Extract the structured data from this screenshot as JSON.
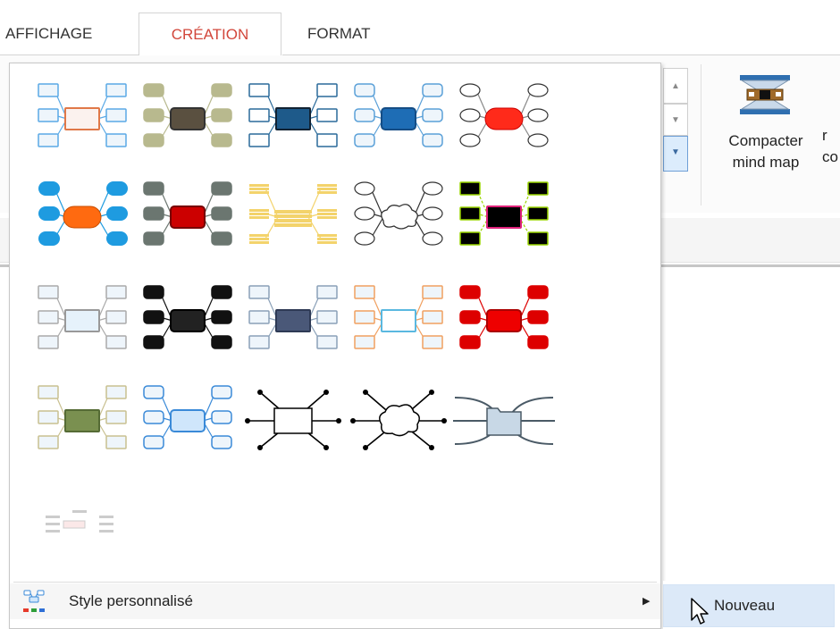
{
  "tabs": [
    {
      "label": "AFFICHAGE",
      "active": false
    },
    {
      "label": "CRÉATION",
      "active": true
    },
    {
      "label": "FORMAT",
      "active": false
    }
  ],
  "ribbon": {
    "compact_button": {
      "line1": "Compacter",
      "line2": "mind map",
      "icon": "compact-mindmap-icon"
    },
    "clipped_label": "r\nco"
  },
  "gallery": {
    "styles": [
      {
        "name": "style-1",
        "node": "#5aa9e6",
        "center_fill": "#fbf2ee",
        "center_stroke": "#e07848",
        "shape": "rect"
      },
      {
        "name": "style-2",
        "node": "#b8b98e",
        "center_fill": "#5a5040",
        "center_stroke": "#333",
        "shape": "round"
      },
      {
        "name": "style-3",
        "node": "#2a6a9a",
        "center_fill": "#1e5a8a",
        "center_stroke": "#123",
        "shape": "rect"
      },
      {
        "name": "style-4",
        "node": "#5aa0d8",
        "center_fill": "#1e6db5",
        "center_stroke": "#154d85",
        "shape": "round"
      },
      {
        "name": "style-5",
        "node": "#888",
        "center_fill": "#ff2a1a",
        "center_stroke": "#c00",
        "shape": "ellipse"
      },
      {
        "name": "style-6",
        "node": "#1e9be0",
        "center_fill": "#ff6a10",
        "center_stroke": "#c94e00",
        "shape": "pill"
      },
      {
        "name": "style-7",
        "node": "#6b7670",
        "center_fill": "#cc0000",
        "center_stroke": "#700",
        "shape": "round"
      },
      {
        "name": "style-8",
        "node": "#f3d36b",
        "center_fill": "#f6e4a8",
        "center_stroke": "#d8b34a",
        "shape": "lines"
      },
      {
        "name": "style-9",
        "node": "#333",
        "center_fill": "#ffffff",
        "center_stroke": "#333",
        "shape": "cloud"
      },
      {
        "name": "style-10",
        "node": "#9ad500",
        "center_fill": "#000000",
        "center_stroke": "#e0217a",
        "shape": "rect"
      },
      {
        "name": "style-11",
        "node": "#aaa",
        "center_fill": "#e6f2fb",
        "center_stroke": "#999",
        "shape": "rect"
      },
      {
        "name": "style-12",
        "node": "#111",
        "center_fill": "#222222",
        "center_stroke": "#000",
        "shape": "round"
      },
      {
        "name": "style-13",
        "node": "#8aa0b8",
        "center_fill": "#4a5878",
        "center_stroke": "#2e3a55",
        "shape": "rect"
      },
      {
        "name": "style-14",
        "node": "#f0a060",
        "center_fill": "#ffffff",
        "center_stroke": "#5ab8e0",
        "shape": "rect"
      },
      {
        "name": "style-15",
        "node": "#dd0000",
        "center_fill": "#ee0000",
        "center_stroke": "#a00",
        "shape": "round"
      },
      {
        "name": "style-16",
        "node": "#c8c090",
        "center_fill": "#7a9050",
        "center_stroke": "#556b35",
        "shape": "rect"
      },
      {
        "name": "style-17",
        "node": "#3a8ad8",
        "center_fill": "#cfe6fb",
        "center_stroke": "#3a8ad8",
        "shape": "round"
      },
      {
        "name": "style-18",
        "node": "#000",
        "center_fill": "#ffffff",
        "center_stroke": "#000",
        "shape": "arrows"
      },
      {
        "name": "style-19",
        "node": "#000",
        "center_fill": "#ffffff",
        "center_stroke": "#000",
        "shape": "cloud-arrows"
      },
      {
        "name": "style-20",
        "node": "#4a5a66",
        "center_fill": "#c8d8e6",
        "center_stroke": "#4a5a66",
        "shape": "folder"
      },
      {
        "name": "style-21",
        "node": "#bbb",
        "center_fill": "#fbe8e8",
        "center_stroke": "#ccc",
        "shape": "mini"
      }
    ]
  },
  "menu": {
    "custom_style_label": "Style personnalisé",
    "custom_style_icon": "custom-style-icon",
    "submenu_arrow": "▶"
  },
  "submenu": {
    "new_label": "Nouveau"
  }
}
